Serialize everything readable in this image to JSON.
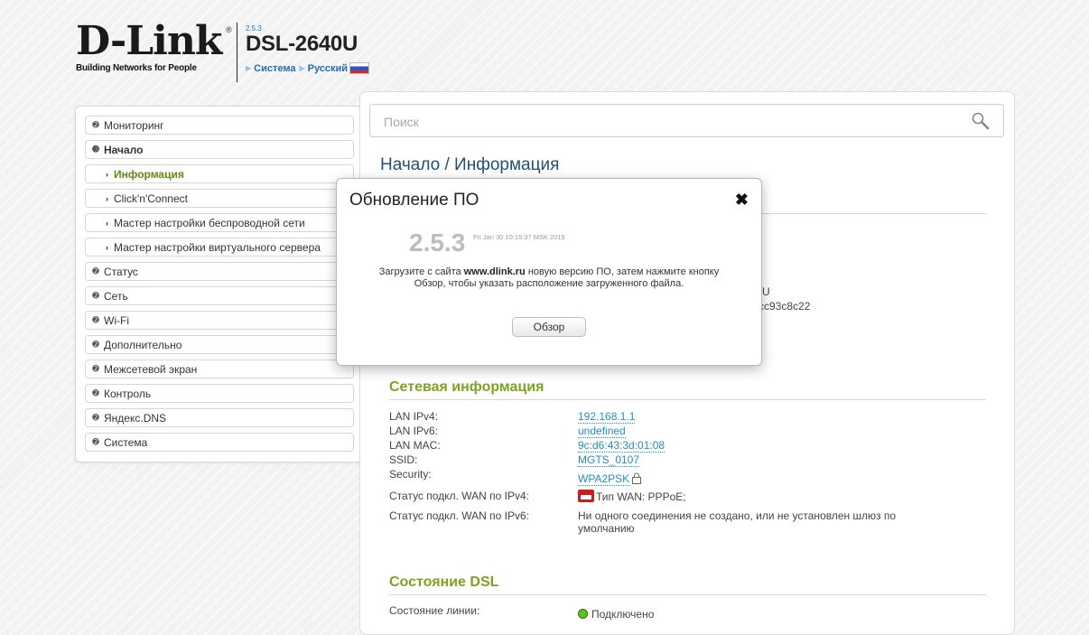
{
  "header": {
    "logo_text": "D-Link",
    "logo_slogan": "Building Networks for People",
    "firmware_small": "2.5.3",
    "model": "DSL-2640U",
    "links": [
      "Система",
      "Русский"
    ]
  },
  "search": {
    "placeholder": "Поиск"
  },
  "sidebar": {
    "items": [
      {
        "label": "Мониторинг",
        "state": "collapsed"
      },
      {
        "label": "Начало",
        "state": "expanded"
      },
      {
        "label": "Информация",
        "sub": true,
        "active": true
      },
      {
        "label": "Click'n'Connect",
        "sub": true
      },
      {
        "label": "Мастер настройки беспроводной сети",
        "sub": true
      },
      {
        "label": "Мастер настройки виртуального сервера",
        "sub": true
      },
      {
        "label": "Статус"
      },
      {
        "label": "Сеть"
      },
      {
        "label": "Wi-Fi"
      },
      {
        "label": "Дополнительно"
      },
      {
        "label": "Межсетевой экран"
      },
      {
        "label": "Контроль"
      },
      {
        "label": "Яндекс.DNS"
      },
      {
        "label": "Система"
      }
    ]
  },
  "main": {
    "title": "Начало /  Информация",
    "partial_info_1": "U",
    "partial_info_2": "cc93c8c22",
    "network": {
      "title": "Сетевая информация",
      "rows": [
        {
          "label": "LAN IPv4:",
          "value": "192.168.1.1"
        },
        {
          "label": "LAN IPv6:",
          "value": "undefined"
        },
        {
          "label": "LAN MAC:",
          "value": "9c:d6:43:3d:01:08"
        },
        {
          "label": "SSID:",
          "value": "MGTS_0107"
        },
        {
          "label": "Security:",
          "value": "WPA2PSK"
        },
        {
          "label": "Статус подкл. WAN по IPv4:",
          "value": "Тип WAN: PPPoE;"
        },
        {
          "label": "Статус подкл. WAN по IPv6:",
          "value": "Ни одного соединения не создано, или не установлен шлюз по умолчанию"
        }
      ]
    },
    "dsl": {
      "title": "Состояние DSL",
      "line_label": "Состояние линии:",
      "line_value": "Подключено"
    }
  },
  "modal": {
    "title": "Обновление ПО",
    "close": "✖",
    "version": "2.5.3",
    "build_date": "Fri Jan 30 10:15:37 MSK 2015",
    "text_before": "Загрузите с сайта ",
    "site": "www.dlink.ru",
    "text_after": " новую версию ПО, затем нажмите кнопку Обзор, чтобы указать расположение загруженного файла.",
    "button": "Обзор"
  },
  "colors": {
    "accent_green": "#7da41e",
    "link_blue": "#1f8fd4",
    "title_blue": "#1f4f7a"
  }
}
